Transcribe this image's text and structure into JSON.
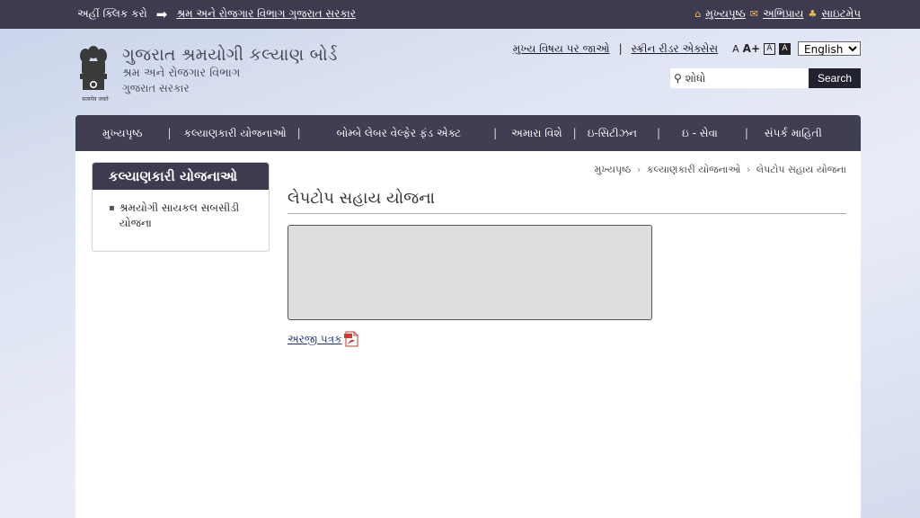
{
  "topbar": {
    "click_here": "અહીં ક્લિક કરો",
    "dept_link": "શ્રમ અને રોજગાર વિભાગ ગુજરાત સરકાર",
    "home": "મુખ્યપૃષ્ઠ",
    "feedback": "અભિપ્રાય",
    "sitemap": "સાઇટમેપ"
  },
  "header": {
    "title": "ગુજરાત શ્રમયોગી કલ્યાણ બોર્ડ",
    "subtitle": "શ્રમ અને રોજગાર વિભાગ",
    "gov": "ગુજરાત સરકાર",
    "emblem_caption": "सत्यमेव जयते",
    "skip_main": "મુખ્ય વિષય પર જાઓ",
    "screen_reader": "સ્ક્રીન રીડર એક્સેસ",
    "font_small": "A",
    "font_large": "A+",
    "contrast_a": "A",
    "contrast_b": "A",
    "language": "English"
  },
  "search": {
    "value": "શોધો",
    "button": "Search"
  },
  "nav": {
    "items": [
      "મુખ્યપૃષ્ઠ",
      "કલ્યાણકારી યોજનાઓ",
      "બોમ્બે લેબર વેલ્ફેર ફંડ એક્ટ",
      "અમારા વિશે",
      "ઇ-સિટીઝન",
      "ઇ - સેવા",
      "સંપર્ક માહિતી"
    ]
  },
  "sidebar": {
    "heading": "કલ્યાણકારી યોજનાઓ",
    "items": [
      "શ્રમયોગી સાયકલ સબસીડી યોજના"
    ]
  },
  "breadcrumb": [
    "મુખ્યપૃષ્ઠ",
    "કલ્યાણકારી યોજનાઓ",
    "લેપટોપ સહાય યોજના"
  ],
  "page": {
    "title": "લેપટોપ સહાય યોજના",
    "application_link": "અરજી પત્રક"
  }
}
